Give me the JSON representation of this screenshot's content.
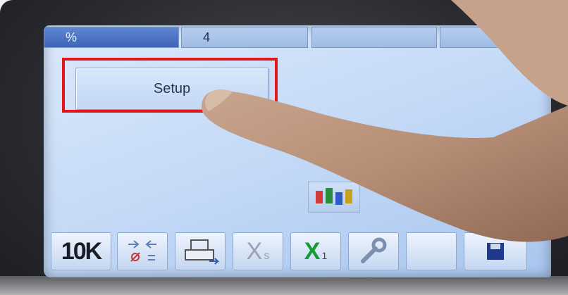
{
  "tabs": [
    {
      "label": "%",
      "active": true
    },
    {
      "label": "4",
      "active": false
    },
    {
      "label": "",
      "active": false
    },
    {
      "label": "",
      "active": false
    }
  ],
  "main": {
    "setup_label": "Setup"
  },
  "highlight": {
    "color": "#e3171b"
  },
  "bottom_bar": {
    "btn_counter": "10K",
    "btn_xs_label": "X",
    "btn_xs_sub": "s",
    "btn_x1_label": "X",
    "btn_x1_sub": "1"
  },
  "icons": {
    "counter": "counter-icon",
    "sort": "sort-arrows-icon",
    "printer": "printer-icon",
    "xs": "x-sub-s-icon",
    "x1": "x-sub-1-icon",
    "wrench": "wrench-icon",
    "blank": "blank-icon",
    "save": "save-icon"
  }
}
